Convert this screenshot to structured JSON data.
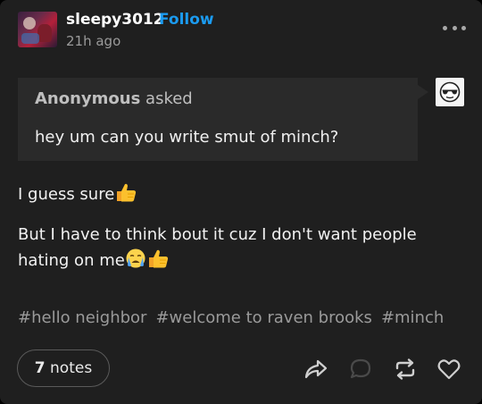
{
  "header": {
    "username": "sleepy3012",
    "follow_label": "Follow",
    "timestamp": "21h ago"
  },
  "ask": {
    "asker": "Anonymous",
    "asked_label": "asked",
    "question": "hey um can you write smut of minch?"
  },
  "body": {
    "line1": "I guess sure",
    "line2": "But I have to think bout it cuz I don't want people hating on me"
  },
  "tags": [
    "#hello neighbor",
    "#welcome to raven brooks",
    "#minch"
  ],
  "footer": {
    "notes_count": "7",
    "notes_label": "notes"
  },
  "colors": {
    "background": "#1f1f1f",
    "ask_background": "#2a2a2a",
    "follow_accent": "#1b9bf0",
    "muted_text": "#9a9a9a"
  },
  "icons": [
    "more-options-icon",
    "anonymous-sunglasses-icon",
    "thumbs-up-emoji",
    "crying-face-emoji",
    "share-icon",
    "reply-icon",
    "reblog-icon",
    "like-heart-icon"
  ]
}
